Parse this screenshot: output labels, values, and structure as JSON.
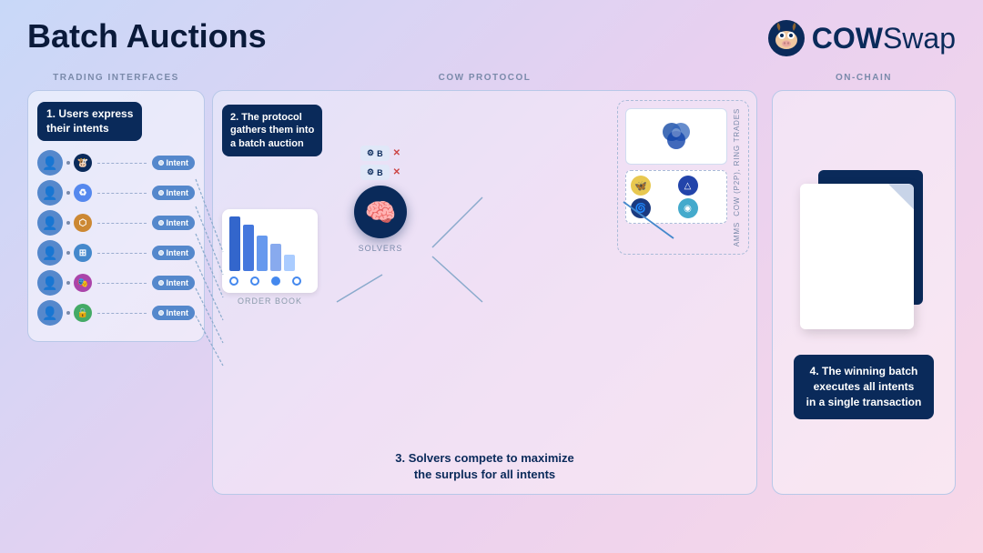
{
  "header": {
    "title": "Batch Auctions",
    "logo_text_cow": "COW",
    "logo_text_swap": "Swap"
  },
  "sections": {
    "trading_label": "TRADING INTERFACES",
    "protocol_label": "COW PROTOCOL",
    "onchain_label": "ON-CHAIN"
  },
  "steps": {
    "step1": "1. Users express\ntheir intents",
    "step2_line1": "2. The protocol",
    "step2_line2": "gathers them into",
    "step2_line3": "a batch auction",
    "step3": "3. Solvers compete to maximize\nthe surplus for all intents",
    "step4_line1": "4. The winning batch",
    "step4_line2": "executes all intents",
    "step4_line3": "in a single transaction"
  },
  "labels": {
    "intent": "Intent",
    "solvers": "SOLVERS",
    "order_book": "ORDER BOOK",
    "cow_ring": "CoW (P2P), Ring Trades",
    "amms": "AMMs"
  },
  "intents": [
    {
      "token": "🐮",
      "bg": "#0a2a5a"
    },
    {
      "token": "♻",
      "bg": "#5588ee"
    },
    {
      "token": "⬡",
      "bg": "#cc8833"
    },
    {
      "token": "⊞",
      "bg": "#4488cc"
    },
    {
      "token": "🎭",
      "bg": "#aa44aa"
    },
    {
      "token": "🔒",
      "bg": "#44aa66"
    }
  ],
  "colors": {
    "dark_navy": "#0a2a5a",
    "medium_blue": "#5588cc",
    "light_blue": "#b8c8e8",
    "accent_blue": "#4488ee",
    "bg_gradient_start": "#c8d8f8",
    "bg_gradient_end": "#f8d8e8"
  }
}
